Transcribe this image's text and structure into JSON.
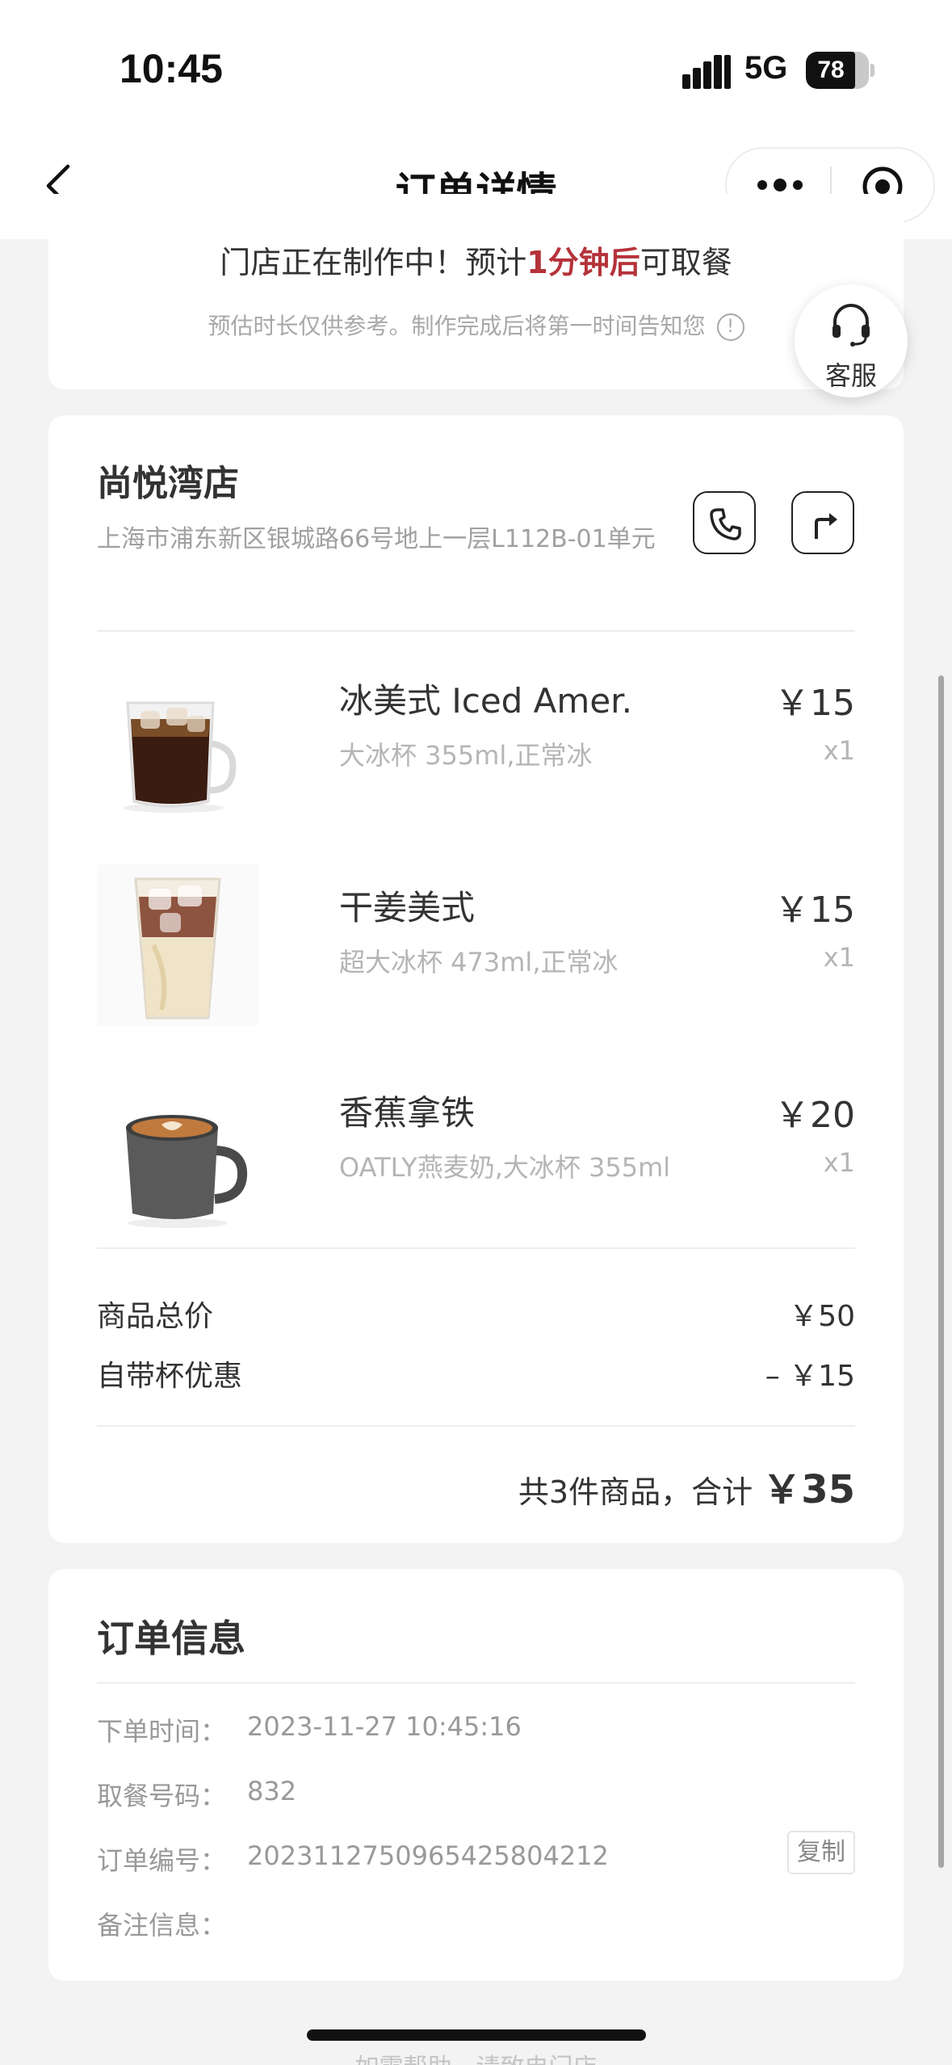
{
  "status_bar": {
    "time": "10:45",
    "network": "5G",
    "battery": "78",
    "battery_level": 0.78
  },
  "nav": {
    "title": "订单详情",
    "more_icon": "more-dots-icon",
    "close_icon": "record-circle-icon"
  },
  "progress": {
    "prefix": "门店正在制作中！预计",
    "highlight": "1分钟后",
    "suffix": "可取餐",
    "note": "预估时长仅供参考。制作完成后将第一时间告知您",
    "info_icon": "!",
    "highlight_color": "#b5333a"
  },
  "service": {
    "label": "客服",
    "icon": "headset-icon"
  },
  "store": {
    "name": "尚悦湾店",
    "address": "上海市浦东新区银城路66号地上一层L112B-01单元",
    "phone_icon": "phone-icon",
    "navigate_icon": "route-arrow-icon"
  },
  "items": [
    {
      "name": "冰美式 Iced Amer.",
      "spec": "大冰杯 355ml,正常冰",
      "price": "￥15",
      "qty": "x1"
    },
    {
      "name": "干姜美式",
      "spec": "超大冰杯 473ml,正常冰",
      "price": "￥15",
      "qty": "x1"
    },
    {
      "name": "香蕉拿铁",
      "spec": "OATLY燕麦奶,大冰杯 355ml",
      "price": "￥20",
      "qty": "x1"
    }
  ],
  "summary": {
    "subtotal_label": "商品总价",
    "subtotal_value": "￥50",
    "discount_label": "自带杯优惠",
    "discount_value": "– ￥15",
    "total_prefix": "共3件商品，合计",
    "total_value": "￥35"
  },
  "order_info": {
    "title": "订单信息",
    "rows": [
      {
        "label": "下单时间：",
        "value": "2023-11-27 10:45:16"
      },
      {
        "label": "取餐号码：",
        "value": "832"
      },
      {
        "label": "订单编号：",
        "value": "20231127509654258042​12"
      },
      {
        "label": "备注信息：",
        "value": ""
      }
    ],
    "copy_label": "复制"
  },
  "footer": {
    "hint": "如需帮助，请致电门店"
  }
}
